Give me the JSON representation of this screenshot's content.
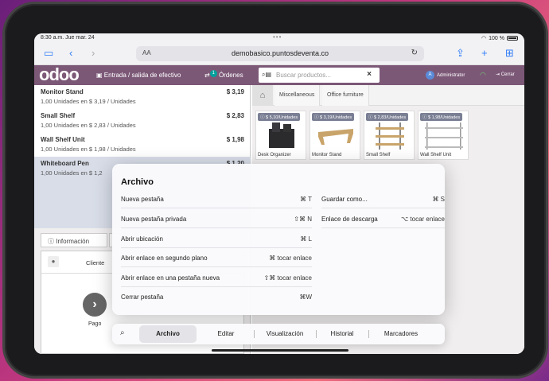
{
  "status": {
    "time": "8:30 a.m.  Jue mar. 24",
    "battery": "100 %"
  },
  "browser": {
    "aa": "AA",
    "url": "demobasico.puntosdeventa.co"
  },
  "pos": {
    "logo": "odoo",
    "cash_label": "Entrada / salida de efectivo",
    "orders_badge": "1",
    "orders_label": "Órdenes",
    "search_placeholder": "Buscar productos...",
    "user": "Administrator",
    "avatar": "A",
    "close_label": "Cerrar",
    "orderlines": [
      {
        "name": "Monitor Stand",
        "price": "$ 3,19",
        "info": "1,00 Unidades en $ 3,19 / Unidades"
      },
      {
        "name": "Small Shelf",
        "price": "$ 2,83",
        "info": "1,00 Unidades en $ 2,83 / Unidades"
      },
      {
        "name": "Wall Shelf Unit",
        "price": "$ 1,98",
        "info": "1,00 Unidades en $ 1,98 / Unidades"
      },
      {
        "name": "Whiteboard Pen",
        "price": "$ 1,20",
        "info": "1,00 Unidades en $ 1,2"
      }
    ],
    "info_tab": "Información",
    "client_label": "Cliente",
    "pay_label": "Pago",
    "categories": [
      "Miscellaneous",
      "Office furniture"
    ],
    "products": [
      {
        "tag": "$ 5,10/Unidades",
        "name": "Desk Organizer"
      },
      {
        "tag": "$ 3,19/Unidades",
        "name": "Monitor Stand"
      },
      {
        "tag": "$ 2,83/Unidades",
        "name": "Small Shelf"
      },
      {
        "tag": "$ 1,98/Unidades",
        "name": "Wall Shelf Unit"
      }
    ]
  },
  "menu": {
    "title": "Archivo",
    "left": [
      {
        "label": "Nueva pestaña",
        "shortcut": "⌘ T"
      },
      {
        "label": "Nueva pestaña privada",
        "shortcut": "⇧⌘ N"
      },
      {
        "label": "Abrir ubicación",
        "shortcut": "⌘ L"
      },
      {
        "label": "Abrir enlace en segundo plano",
        "shortcut": "⌘ tocar enlace"
      },
      {
        "label": "Abrir enlace en una pestaña nueva",
        "shortcut": "⇧⌘ tocar enlace"
      },
      {
        "label": "Cerrar pestaña",
        "shortcut": "⌘W"
      }
    ],
    "right": [
      {
        "label": "Guardar como...",
        "shortcut": "⌘ S"
      },
      {
        "label": "Enlace de descarga",
        "shortcut": "⌥ tocar enlace"
      }
    ],
    "bar": [
      "Archivo",
      "Editar",
      "Visualización",
      "Historial",
      "Marcadores"
    ]
  }
}
